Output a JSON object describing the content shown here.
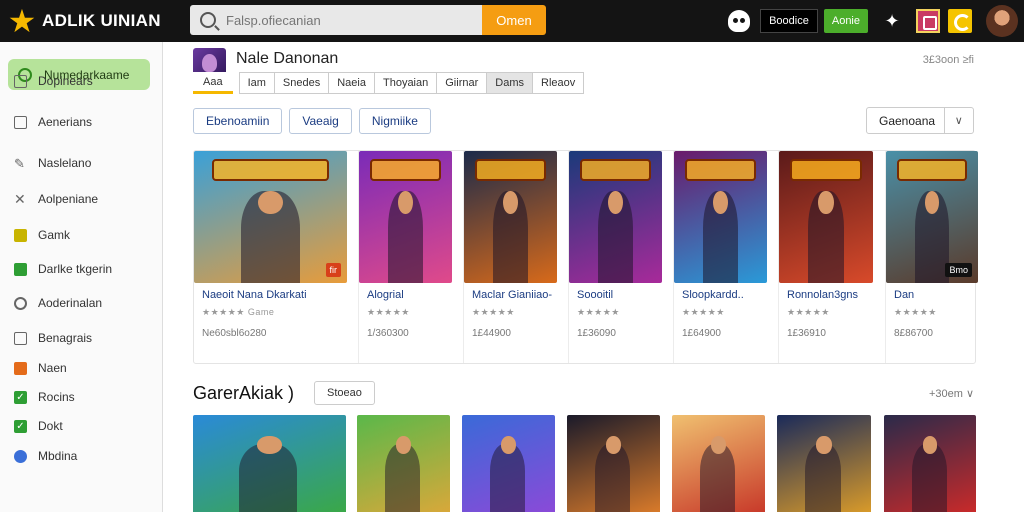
{
  "app": {
    "brand": "ADLIK UINIAN",
    "search_placeholder": "Falsp.ofiecanian",
    "search_button": "Omen",
    "topbar_dark_button": "Boodice",
    "topbar_green_button": "Aonie"
  },
  "sidebar": {
    "active": "Numedarkaame",
    "items": [
      {
        "label": "Dopinears",
        "icon": "window-icon",
        "color": "#666666"
      },
      {
        "label": "Aenerians",
        "icon": "grid-icon",
        "color": "#666666"
      },
      {
        "label": "Naslelano",
        "icon": "pencil-icon",
        "color": "#666666"
      },
      {
        "label": "Aolpeniane",
        "icon": "cross-icon",
        "color": "#666666"
      },
      {
        "label": "Gamk",
        "icon": "square-yellow-icon",
        "color": "#c8b400"
      },
      {
        "label": "Darlke tkgerin",
        "icon": "square-green-icon",
        "color": "#2e9e34"
      },
      {
        "label": "Aoderinalan",
        "icon": "circle-icon",
        "color": "#666666"
      },
      {
        "label": "Benagrais",
        "icon": "tag-icon",
        "color": "#666666"
      },
      {
        "label": "Naen",
        "icon": "square-orange-icon",
        "color": "#e46b1a"
      },
      {
        "label": "Rocins",
        "icon": "check-green-icon",
        "color": "#2e9e34"
      },
      {
        "label": "Dokt",
        "icon": "check-green-icon",
        "color": "#2e9e34"
      },
      {
        "label": "Mbdina",
        "icon": "circle-blue-icon",
        "color": "#3a6fd8"
      }
    ]
  },
  "page": {
    "title": "Nale Danonan",
    "count": "3£3oon ≥fi",
    "tabs": [
      "Aaa",
      "Iam",
      "Snedes",
      "Naeia",
      "Thoyaian",
      "Giirnar",
      "Dams",
      "Rleaov"
    ],
    "filters": [
      "Ebenoamiin",
      "Vaeaig",
      "Nigmiike"
    ],
    "sort_label": "Gaenoana"
  },
  "row1": [
    {
      "name": "Naeoit Nana Dkarkati",
      "stars": "★★★★★ Game",
      "sub": "Ne60sbl6o280",
      "badge": "fir",
      "bg1": "#3aa0d8",
      "bg2": "#e89c3a"
    },
    {
      "name": "Alogrial",
      "stars": "★★★★★",
      "sub": "1/360300",
      "badge": "",
      "bg1": "#7a2bb8",
      "bg2": "#e04a8a"
    },
    {
      "name": "Maclar Gianiiao-",
      "stars": "★★★★★",
      "sub": "1£44900",
      "badge": "",
      "bg1": "#1b2a4a",
      "bg2": "#d86a1a"
    },
    {
      "name": "Soooitil",
      "stars": "★★★★★",
      "sub": "1£36090",
      "badge": "",
      "bg1": "#1a3a7a",
      "bg2": "#a82a9a"
    },
    {
      "name": "Sloopkardd..",
      "stars": "★★★★★",
      "sub": "1£64900",
      "badge": "",
      "bg1": "#6a1a6a",
      "bg2": "#2a9ad8"
    },
    {
      "name": "Ronnolan3gns",
      "stars": "★★★★★",
      "sub": "1£36910",
      "badge": "",
      "bg1": "#5a1a1a",
      "bg2": "#d84a2a"
    },
    {
      "name": "Dan",
      "stars": "★★★★★",
      "sub": "8£86700",
      "badge": "Bmo",
      "bg1": "#4a90a8",
      "bg2": "#5a3a2a"
    }
  ],
  "section2": {
    "title": "GarerAkiak )",
    "button": "Stoeao",
    "more": "+30em"
  },
  "row2": [
    {
      "bg1": "#2a8ad8",
      "bg2": "#3aa848"
    },
    {
      "bg1": "#5ab84a",
      "bg2": "#d8a83a"
    },
    {
      "bg1": "#3a6ad8",
      "bg2": "#8a4ad8"
    },
    {
      "bg1": "#1a1a2a",
      "bg2": "#d87a2a"
    },
    {
      "bg1": "#f0c070",
      "bg2": "#c83a2a"
    },
    {
      "bg1": "#1a2a5a",
      "bg2": "#d89a2a"
    },
    {
      "bg1": "#2a2a4a",
      "bg2": "#c82a2a"
    }
  ]
}
